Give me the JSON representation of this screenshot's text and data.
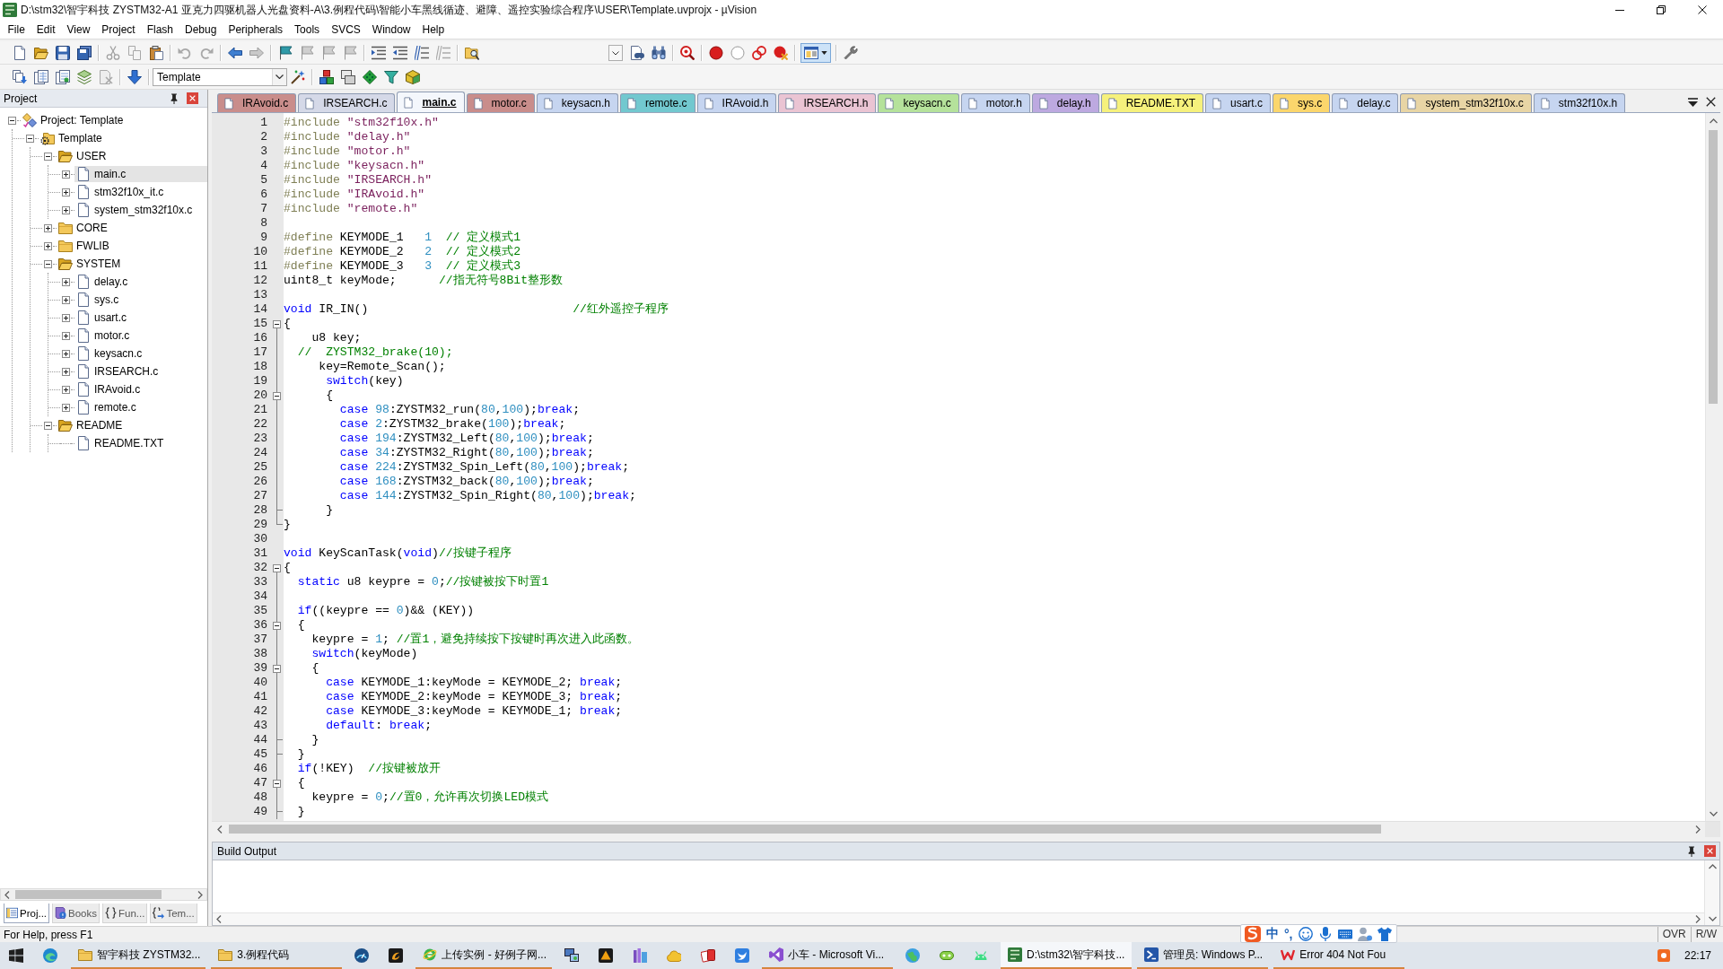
{
  "window": {
    "title": "D:\\stm32\\智宇科技 ZYSTM32-A1 亚克力四驱机器人光盘资料-A\\3.例程代码\\智能小车黑线循迹、避障、遥控实验综合程序\\USER\\Template.uvprojx - µVision"
  },
  "menu": [
    "File",
    "Edit",
    "View",
    "Project",
    "Flash",
    "Debug",
    "Peripherals",
    "Tools",
    "SVCS",
    "Window",
    "Help"
  ],
  "file_toolbar": {
    "window_layout_button": {
      "on": true
    }
  },
  "build_toolbar": {
    "target": "Template"
  },
  "project_panel": {
    "title": "Project",
    "tree": [
      {
        "kind": "project",
        "label": "Project: Template",
        "expanded": true,
        "selected": false,
        "children": [
          {
            "kind": "target",
            "label": "Template",
            "expanded": true,
            "selected": false,
            "children": [
              {
                "kind": "group",
                "label": "USER",
                "expanded": true,
                "selected": false,
                "children": [
                  {
                    "kind": "file",
                    "label": "main.c",
                    "expanded": false,
                    "selected": true
                  },
                  {
                    "kind": "file",
                    "label": "stm32f10x_it.c",
                    "expanded": false,
                    "selected": false
                  },
                  {
                    "kind": "file",
                    "label": "system_stm32f10x.c",
                    "expanded": false,
                    "selected": false
                  }
                ]
              },
              {
                "kind": "group",
                "label": "CORE",
                "expanded": false,
                "selected": false
              },
              {
                "kind": "group",
                "label": "FWLIB",
                "expanded": false,
                "selected": false
              },
              {
                "kind": "group",
                "label": "SYSTEM",
                "expanded": true,
                "selected": false,
                "children": [
                  {
                    "kind": "file",
                    "label": "delay.c",
                    "expanded": false,
                    "selected": false
                  },
                  {
                    "kind": "file",
                    "label": "sys.c",
                    "expanded": false,
                    "selected": false
                  },
                  {
                    "kind": "file",
                    "label": "usart.c",
                    "expanded": false,
                    "selected": false
                  },
                  {
                    "kind": "file",
                    "label": "motor.c",
                    "expanded": false,
                    "selected": false
                  },
                  {
                    "kind": "file",
                    "label": "keysacn.c",
                    "expanded": false,
                    "selected": false
                  },
                  {
                    "kind": "file",
                    "label": "IRSEARCH.c",
                    "expanded": false,
                    "selected": false
                  },
                  {
                    "kind": "file",
                    "label": "IRAvoid.c",
                    "expanded": false,
                    "selected": false
                  },
                  {
                    "kind": "file",
                    "label": "remote.c",
                    "expanded": false,
                    "selected": false
                  }
                ]
              },
              {
                "kind": "group",
                "label": "README",
                "expanded": true,
                "selected": false,
                "children": [
                  {
                    "kind": "file",
                    "label": "README.TXT",
                    "selected": false
                  }
                ]
              }
            ]
          }
        ]
      }
    ],
    "tabs": [
      {
        "label": "Proj...",
        "selected": true
      },
      {
        "label": "Books",
        "selected": false
      },
      {
        "label": "Fun...",
        "selected": false
      },
      {
        "label": "Tem...",
        "selected": false
      }
    ]
  },
  "editor": {
    "tabs": [
      {
        "label": "IRAvoid.c",
        "color": "#c98d8b",
        "selected": false
      },
      {
        "label": "IRSEARCH.c",
        "color": "#d5d9e8",
        "selected": false
      },
      {
        "label": "main.c",
        "color": "#f4f7fc",
        "selected": true
      },
      {
        "label": "motor.c",
        "color": "#c98d8b",
        "selected": false
      },
      {
        "label": "keysacn.h",
        "color": "#c6d5f0",
        "selected": false
      },
      {
        "label": "remote.c",
        "color": "#72c8cf",
        "selected": false
      },
      {
        "label": "IRAvoid.h",
        "color": "#c6d5f0",
        "selected": false
      },
      {
        "label": "IRSEARCH.h",
        "color": "#eac4d3",
        "selected": false
      },
      {
        "label": "keysacn.c",
        "color": "#b5e29b",
        "selected": false
      },
      {
        "label": "motor.h",
        "color": "#c6d5f0",
        "selected": false
      },
      {
        "label": "delay.h",
        "color": "#bda9e0",
        "selected": false
      },
      {
        "label": "README.TXT",
        "color": "#f6f17c",
        "selected": false
      },
      {
        "label": "usart.c",
        "color": "#c6d5f0",
        "selected": false
      },
      {
        "label": "sys.c",
        "color": "#fbd66c",
        "selected": false
      },
      {
        "label": "delay.c",
        "color": "#c6d5f0",
        "selected": false
      },
      {
        "label": "system_stm32f10x.c",
        "color": "#e8d5a5",
        "selected": false
      },
      {
        "label": "stm32f10x.h",
        "color": "#c6d5f0",
        "selected": false
      }
    ],
    "lines": [
      {
        "number": "1",
        "tokens": [
          {
            "kind": "directive",
            "text": "#include"
          },
          {
            "kind": "string",
            "text": " \"stm32f10x.h\""
          }
        ]
      },
      {
        "number": "2",
        "tokens": [
          {
            "kind": "directive",
            "text": "#include"
          },
          {
            "kind": "string",
            "text": " \"delay.h\""
          }
        ]
      },
      {
        "number": "3",
        "tokens": [
          {
            "kind": "directive",
            "text": "#include"
          },
          {
            "kind": "string",
            "text": " \"motor.h\""
          }
        ]
      },
      {
        "number": "4",
        "tokens": [
          {
            "kind": "directive",
            "text": "#include"
          },
          {
            "kind": "string",
            "text": " \"keysacn.h\""
          }
        ]
      },
      {
        "number": "5",
        "tokens": [
          {
            "kind": "directive",
            "text": "#include"
          },
          {
            "kind": "string",
            "text": " \"IRSEARCH.h\""
          }
        ]
      },
      {
        "number": "6",
        "tokens": [
          {
            "kind": "directive",
            "text": "#include"
          },
          {
            "kind": "string",
            "text": " \"IRAvoid.h\""
          }
        ]
      },
      {
        "number": "7",
        "tokens": [
          {
            "kind": "directive",
            "text": "#include"
          },
          {
            "kind": "string",
            "text": " \"remote.h\""
          }
        ]
      },
      {
        "number": "8"
      },
      {
        "number": "9",
        "tokens": [
          {
            "kind": "directive",
            "text": "#define"
          },
          {
            "kind": "text",
            "text": " KEYMODE_1   "
          },
          {
            "kind": "number",
            "text": "1"
          },
          {
            "kind": "comment",
            "text": "  // 定义模式1"
          }
        ]
      },
      {
        "number": "10",
        "tokens": [
          {
            "kind": "directive",
            "text": "#define"
          },
          {
            "kind": "text",
            "text": " KEYMODE_2   "
          },
          {
            "kind": "number",
            "text": "2"
          },
          {
            "kind": "comment",
            "text": "  // 定义模式2"
          }
        ]
      },
      {
        "number": "11",
        "tokens": [
          {
            "kind": "directive",
            "text": "#define"
          },
          {
            "kind": "text",
            "text": " KEYMODE_3   "
          },
          {
            "kind": "number",
            "text": "3"
          },
          {
            "kind": "comment",
            "text": "  // 定义模式3"
          }
        ]
      },
      {
        "number": "12",
        "tokens": [
          {
            "kind": "text",
            "text": "uint8_t keyMode;      "
          },
          {
            "kind": "comment",
            "text": "//指无符号8Bit整形数"
          }
        ]
      },
      {
        "number": "13"
      },
      {
        "number": "14",
        "tokens": [
          {
            "kind": "keyword",
            "text": "void"
          },
          {
            "kind": "text",
            "text": " IR_IN()                             "
          },
          {
            "kind": "comment",
            "text": "//红外遥控子程序"
          }
        ]
      },
      {
        "number": "15",
        "expanded": true,
        "tokens": [
          {
            "kind": "text",
            "text": "{"
          }
        ]
      },
      {
        "number": "16",
        "tokens": [
          {
            "kind": "text",
            "text": "    u8 key;"
          }
        ]
      },
      {
        "number": "17",
        "tokens": [
          {
            "kind": "comment",
            "text": "  //  ZYSTM32_brake(10);"
          }
        ]
      },
      {
        "number": "18",
        "tokens": [
          {
            "kind": "text",
            "text": "     key=Remote_Scan();"
          }
        ]
      },
      {
        "number": "19",
        "tokens": [
          {
            "kind": "keyword",
            "text": "      switch"
          },
          {
            "kind": "text",
            "text": "(key)"
          }
        ]
      },
      {
        "number": "20",
        "expanded": true,
        "tokens": [
          {
            "kind": "text",
            "text": "      {"
          }
        ]
      },
      {
        "number": "21",
        "tokens": [
          {
            "kind": "keyword",
            "text": "        case"
          },
          {
            "kind": "number",
            "text": " 98"
          },
          {
            "kind": "text",
            "text": ":ZYSTM32_run("
          },
          {
            "kind": "number",
            "text": "80"
          },
          {
            "kind": "text",
            "text": ","
          },
          {
            "kind": "number",
            "text": "100"
          },
          {
            "kind": "text",
            "text": ");"
          },
          {
            "kind": "keyword",
            "text": "break"
          },
          {
            "kind": "text",
            "text": ";"
          }
        ]
      },
      {
        "number": "22",
        "tokens": [
          {
            "kind": "keyword",
            "text": "        case"
          },
          {
            "kind": "number",
            "text": " 2"
          },
          {
            "kind": "text",
            "text": ":ZYSTM32_brake("
          },
          {
            "kind": "number",
            "text": "100"
          },
          {
            "kind": "text",
            "text": ");"
          },
          {
            "kind": "keyword",
            "text": "break"
          },
          {
            "kind": "text",
            "text": ";"
          }
        ]
      },
      {
        "number": "23",
        "tokens": [
          {
            "kind": "keyword",
            "text": "        case"
          },
          {
            "kind": "number",
            "text": " 194"
          },
          {
            "kind": "text",
            "text": ":ZYSTM32_Left("
          },
          {
            "kind": "number",
            "text": "80"
          },
          {
            "kind": "text",
            "text": ","
          },
          {
            "kind": "number",
            "text": "100"
          },
          {
            "kind": "text",
            "text": ");"
          },
          {
            "kind": "keyword",
            "text": "break"
          },
          {
            "kind": "text",
            "text": ";"
          }
        ]
      },
      {
        "number": "24",
        "tokens": [
          {
            "kind": "keyword",
            "text": "        case"
          },
          {
            "kind": "number",
            "text": " 34"
          },
          {
            "kind": "text",
            "text": ":ZYSTM32_Right("
          },
          {
            "kind": "number",
            "text": "80"
          },
          {
            "kind": "text",
            "text": ","
          },
          {
            "kind": "number",
            "text": "100"
          },
          {
            "kind": "text",
            "text": ");"
          },
          {
            "kind": "keyword",
            "text": "break"
          },
          {
            "kind": "text",
            "text": ";"
          }
        ]
      },
      {
        "number": "25",
        "tokens": [
          {
            "kind": "keyword",
            "text": "        case"
          },
          {
            "kind": "number",
            "text": " 224"
          },
          {
            "kind": "text",
            "text": ":ZYSTM32_Spin_Left("
          },
          {
            "kind": "number",
            "text": "80"
          },
          {
            "kind": "text",
            "text": ","
          },
          {
            "kind": "number",
            "text": "100"
          },
          {
            "kind": "text",
            "text": ");"
          },
          {
            "kind": "keyword",
            "text": "break"
          },
          {
            "kind": "text",
            "text": ";"
          }
        ]
      },
      {
        "number": "26",
        "tokens": [
          {
            "kind": "keyword",
            "text": "        case"
          },
          {
            "kind": "number",
            "text": " 168"
          },
          {
            "kind": "text",
            "text": ":ZYSTM32_back("
          },
          {
            "kind": "number",
            "text": "80"
          },
          {
            "kind": "text",
            "text": ","
          },
          {
            "kind": "number",
            "text": "100"
          },
          {
            "kind": "text",
            "text": ");"
          },
          {
            "kind": "keyword",
            "text": "break"
          },
          {
            "kind": "text",
            "text": ";"
          }
        ]
      },
      {
        "number": "27",
        "tokens": [
          {
            "kind": "keyword",
            "text": "        case"
          },
          {
            "kind": "number",
            "text": " 144"
          },
          {
            "kind": "text",
            "text": ":ZYSTM32_Spin_Right("
          },
          {
            "kind": "number",
            "text": "80"
          },
          {
            "kind": "text",
            "text": ","
          },
          {
            "kind": "number",
            "text": "100"
          },
          {
            "kind": "text",
            "text": ");"
          },
          {
            "kind": "keyword",
            "text": "break"
          },
          {
            "kind": "text",
            "text": ";"
          }
        ]
      },
      {
        "number": "28",
        "fold_end": true,
        "tokens": [
          {
            "kind": "text",
            "text": "      }"
          }
        ]
      },
      {
        "number": "29",
        "fold_end": true,
        "tokens": [
          {
            "kind": "text",
            "text": "}"
          }
        ]
      },
      {
        "number": "30"
      },
      {
        "number": "31",
        "tokens": [
          {
            "kind": "keyword",
            "text": "void"
          },
          {
            "kind": "text",
            "text": " KeyScanTask("
          },
          {
            "kind": "keyword",
            "text": "void"
          },
          {
            "kind": "text",
            "text": ")"
          },
          {
            "kind": "comment",
            "text": "//按键子程序"
          }
        ]
      },
      {
        "number": "32",
        "expanded": true,
        "tokens": [
          {
            "kind": "text",
            "text": "{"
          }
        ]
      },
      {
        "number": "33",
        "tokens": [
          {
            "kind": "keyword",
            "text": "  static"
          },
          {
            "kind": "text",
            "text": " u8 keypre = "
          },
          {
            "kind": "number",
            "text": "0"
          },
          {
            "kind": "text",
            "text": ";"
          },
          {
            "kind": "comment",
            "text": "//按键被按下时置1"
          }
        ]
      },
      {
        "number": "34"
      },
      {
        "number": "35",
        "tokens": [
          {
            "kind": "keyword",
            "text": "  if"
          },
          {
            "kind": "text",
            "text": "((keypre == "
          },
          {
            "kind": "number",
            "text": "0"
          },
          {
            "kind": "text",
            "text": ")&& (KEY))"
          }
        ]
      },
      {
        "number": "36",
        "expanded": true,
        "tokens": [
          {
            "kind": "text",
            "text": "  {"
          }
        ]
      },
      {
        "number": "37",
        "tokens": [
          {
            "kind": "text",
            "text": "    keypre = "
          },
          {
            "kind": "number",
            "text": "1"
          },
          {
            "kind": "text",
            "text": "; "
          },
          {
            "kind": "comment",
            "text": "//置1，避免持续按下按键时再次进入此函数。"
          }
        ]
      },
      {
        "number": "38",
        "tokens": [
          {
            "kind": "keyword",
            "text": "    switch"
          },
          {
            "kind": "text",
            "text": "(keyMode)"
          }
        ]
      },
      {
        "number": "39",
        "expanded": true,
        "tokens": [
          {
            "kind": "text",
            "text": "    {"
          }
        ]
      },
      {
        "number": "40",
        "tokens": [
          {
            "kind": "keyword",
            "text": "      case"
          },
          {
            "kind": "text",
            "text": " KEYMODE_1:keyMode = KEYMODE_2; "
          },
          {
            "kind": "keyword",
            "text": "break"
          },
          {
            "kind": "text",
            "text": ";"
          }
        ]
      },
      {
        "number": "41",
        "tokens": [
          {
            "kind": "keyword",
            "text": "      case"
          },
          {
            "kind": "text",
            "text": " KEYMODE_2:keyMode = KEYMODE_3; "
          },
          {
            "kind": "keyword",
            "text": "break"
          },
          {
            "kind": "text",
            "text": ";"
          }
        ]
      },
      {
        "number": "42",
        "tokens": [
          {
            "kind": "keyword",
            "text": "      case"
          },
          {
            "kind": "text",
            "text": " KEYMODE_3:keyMode = KEYMODE_1; "
          },
          {
            "kind": "keyword",
            "text": "break"
          },
          {
            "kind": "text",
            "text": ";"
          }
        ]
      },
      {
        "number": "43",
        "tokens": [
          {
            "kind": "keyword",
            "text": "      default"
          },
          {
            "kind": "text",
            "text": ": "
          },
          {
            "kind": "keyword",
            "text": "break"
          },
          {
            "kind": "text",
            "text": ";"
          }
        ]
      },
      {
        "number": "44",
        "fold_end": true,
        "tokens": [
          {
            "kind": "text",
            "text": "    }"
          }
        ]
      },
      {
        "number": "45",
        "fold_end": true,
        "tokens": [
          {
            "kind": "text",
            "text": "  }"
          }
        ]
      },
      {
        "number": "46",
        "tokens": [
          {
            "kind": "keyword",
            "text": "  if"
          },
          {
            "kind": "text",
            "text": "(!KEY)  "
          },
          {
            "kind": "comment",
            "text": "//按键被放开"
          }
        ]
      },
      {
        "number": "47",
        "expanded": true,
        "tokens": [
          {
            "kind": "text",
            "text": "  {"
          }
        ]
      },
      {
        "number": "48",
        "tokens": [
          {
            "kind": "text",
            "text": "    keypre = "
          },
          {
            "kind": "number",
            "text": "0"
          },
          {
            "kind": "text",
            "text": ";"
          },
          {
            "kind": "comment",
            "text": "//置0，允许再次切换LED模式"
          }
        ]
      },
      {
        "number": "49",
        "fold_end": true,
        "tokens": [
          {
            "kind": "text",
            "text": "  }"
          }
        ]
      }
    ]
  },
  "build_output": {
    "title": "Build Output"
  },
  "status_bar": {
    "help": "For Help, press F1",
    "indicators": [
      "OVR",
      "R/W"
    ]
  },
  "ime_bar": {
    "mode": "中",
    "punctuation": "°,"
  },
  "taskbar": {
    "windows": [
      {
        "label": "智宇科技 ZYSTM32...",
        "running": true,
        "selected": false
      },
      {
        "label": "3.例程代码",
        "running": true,
        "selected": false
      },
      {
        "label": "上传实例 - 好例子网...",
        "running": true,
        "selected": false
      },
      {
        "label": "小车 - Microsoft Vi...",
        "running": true,
        "selected": false
      },
      {
        "label": "D:\\stm32\\智宇科技...",
        "running": true,
        "selected": true
      },
      {
        "label": "管理员: Windows P...",
        "running": true,
        "selected": false
      },
      {
        "label": "Error 404 Not Fou",
        "running": true,
        "selected": false
      }
    ],
    "clock": "22:17"
  }
}
